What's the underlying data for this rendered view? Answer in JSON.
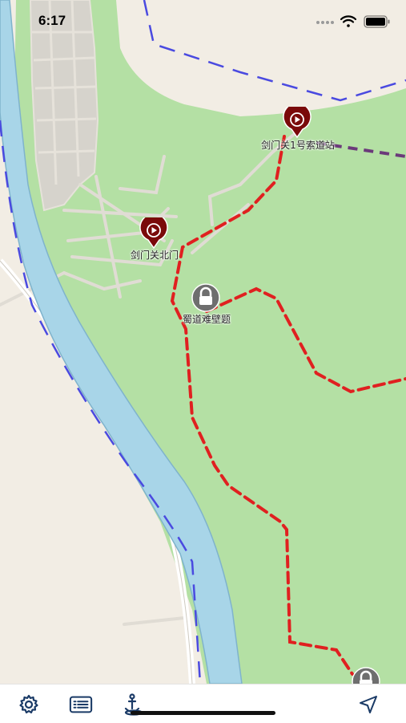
{
  "status_bar": {
    "time": "6:17",
    "icons": [
      "signal-dots-icon",
      "wifi-icon",
      "battery-icon"
    ]
  },
  "map": {
    "colors": {
      "land": "#f2ede4",
      "park": "#b4e0a4",
      "river": "#a8d5e8",
      "river_edge": "#7fb3cc",
      "built_area": "#d6d3cc",
      "path": "#e0dcd4",
      "route": "#e02020",
      "boundary": "#4a4ae0",
      "cableway": "#6b3a7a",
      "poi_marker": "#7a0a0a",
      "lock_marker": "#6e6e6e"
    },
    "pois": [
      {
        "name": "剑门关1号索道站",
        "type": "audio-guide",
        "icon": "play-icon"
      },
      {
        "name": "剑门关北门",
        "type": "audio-guide",
        "icon": "play-icon"
      },
      {
        "name": "蜀道难壁题",
        "type": "locked",
        "icon": "lock-icon"
      },
      {
        "name": "",
        "type": "locked",
        "icon": "lock-icon"
      }
    ]
  },
  "toolbar": {
    "items": [
      {
        "name": "settings",
        "icon": "gear-icon"
      },
      {
        "name": "list",
        "icon": "list-card-icon"
      },
      {
        "name": "anchor",
        "icon": "anchor-pin-icon"
      },
      {
        "name": "locate",
        "icon": "navigation-arrow-icon"
      }
    ]
  }
}
